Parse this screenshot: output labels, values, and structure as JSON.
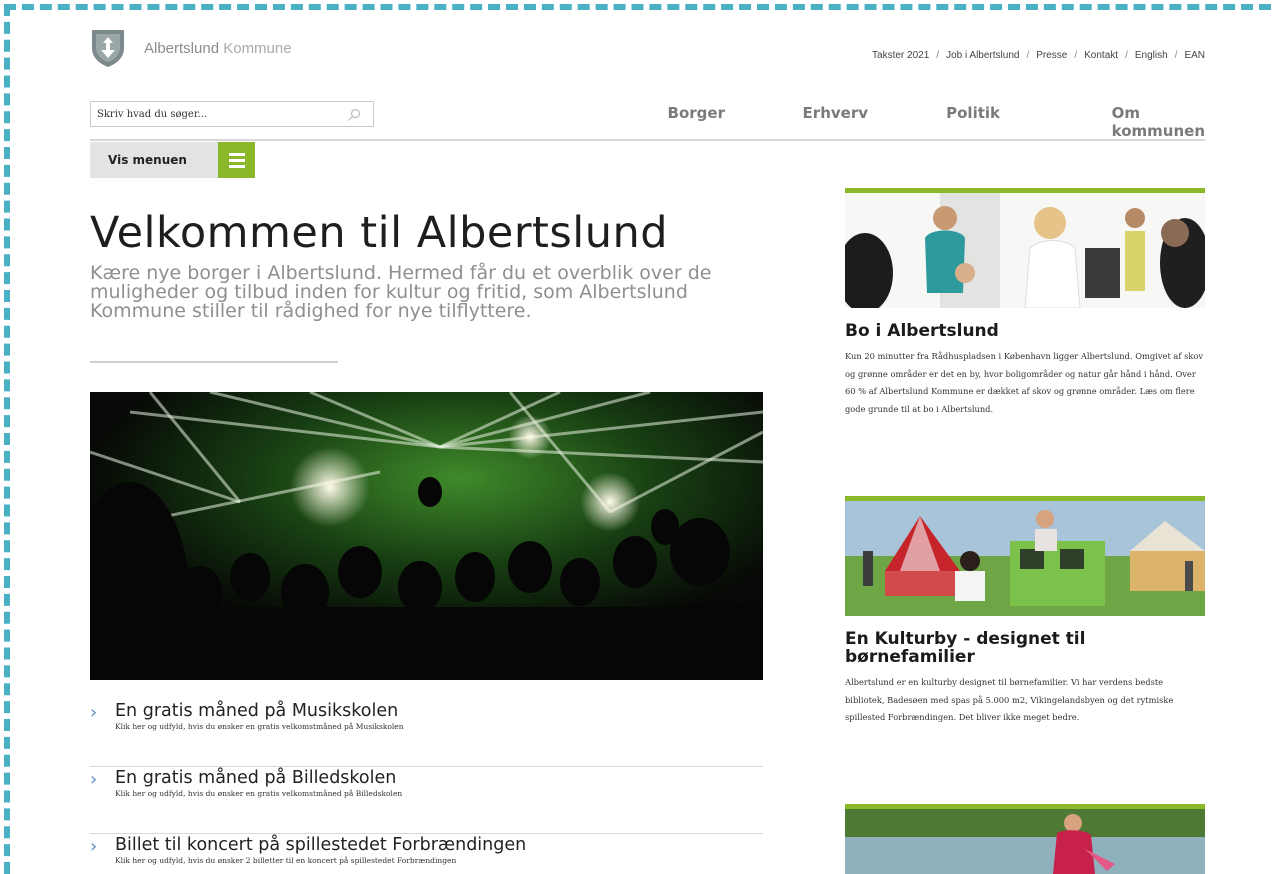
{
  "brand": {
    "name_part1": "Albertslund",
    "name_part2": "Kommune"
  },
  "top_links": [
    "Takster 2021",
    "Job i Albertslund",
    "Presse",
    "Kontakt",
    "English",
    "EAN"
  ],
  "search": {
    "placeholder": "Skriv hvad du søger..."
  },
  "main_nav": [
    "Borger",
    "Erhverv",
    "Politik",
    "Om kommunen"
  ],
  "menu_button": {
    "label": "Vis menuen"
  },
  "hero": {
    "title": "Velkommen til Albertslund",
    "lead": "Kære nye borger i Albertslund. Hermed får du et overblik over de muligheder og tilbud inden for kultur og fritid, som Albertslund Kommune stiller til rådighed for nye tilflyttere."
  },
  "links": [
    {
      "title": "En gratis måned på Musikskolen",
      "description": "Klik her og udfyld, hvis du ønsker en gratis velkomstmåned på Musikskolen"
    },
    {
      "title": "En gratis måned på Billedskolen",
      "description": "Klik her og udfyld, hvis du ønsker en gratis velkomstmåned på Billedskolen"
    },
    {
      "title": "Billet til koncert på spillestedet Forbrændingen",
      "description": "Klik her og udfyld, hvis du ønsker 2 billetter til en koncert på spillestedet Forbrændingen"
    }
  ],
  "sidebar_cards": [
    {
      "title": "Bo i Albertslund",
      "text": "Kun 20 minutter fra Rådhuspladsen i København ligger Albertslund. Omgivet af skov og grønne områder er det en by, hvor boligområder og natur går hånd i hånd. Over 60 % af Albertslund Kommune er dækket af skov og grønne områder. Læs om flere gode grunde til at bo i Albertslund."
    },
    {
      "title": "En Kulturby - designet til børnefamilier",
      "text": "Albertslund er en kulturby designet til børnefamilier. Vi har verdens bedste bibliotek, Badesøen med spas på 5.000 m2, Vikingelandsbyen og det rytmiske spillested Forbrændingen. Det bliver ikke meget bedre."
    }
  ],
  "colors": {
    "accent_green": "#8bb82a",
    "frame_dash": "#4ab0c4",
    "link_chevron": "#5a8ec2"
  }
}
